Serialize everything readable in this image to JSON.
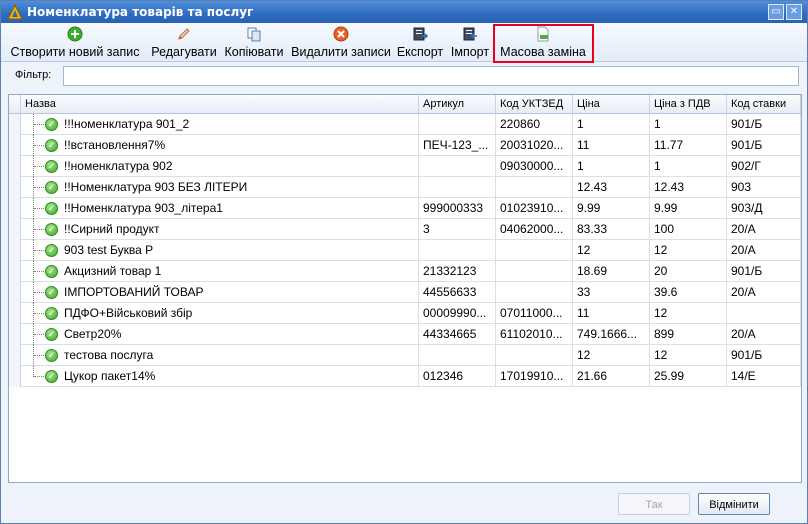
{
  "window": {
    "title": "Номенклатура товарів та послуг"
  },
  "toolbar": {
    "items": [
      {
        "label": "Створити новий запис",
        "icon": "add-icon"
      },
      {
        "label": "Редагувати",
        "icon": "edit-icon"
      },
      {
        "label": "Копіювати",
        "icon": "copy-icon"
      },
      {
        "label": "Видалити записи",
        "icon": "delete-icon"
      },
      {
        "label": "Експорт",
        "icon": "export-icon"
      },
      {
        "label": "Імпорт",
        "icon": "import-icon"
      },
      {
        "label": "Масова заміна",
        "icon": "bulk-replace-icon"
      }
    ],
    "highlight_color": "#e8001c"
  },
  "filter": {
    "label": "Фільтр:",
    "value": ""
  },
  "grid": {
    "columns": [
      "Назва",
      "Артикул",
      "Код УКТЗЕД",
      "Ціна",
      "Ціна з ПДВ",
      "Код ставки"
    ],
    "rows": [
      {
        "name": "!!!номенклатура 901_2",
        "article": "",
        "code": "220860",
        "price": "1",
        "price_vat": "1",
        "rate": "901/Б"
      },
      {
        "name": "!!встановлення7%",
        "article": "ПЕЧ-123_...",
        "code": "20031020...",
        "price": "11",
        "price_vat": "11.77",
        "rate": "901/Б"
      },
      {
        "name": "!!номенклатура 902",
        "article": "",
        "code": "09030000...",
        "price": "1",
        "price_vat": "1",
        "rate": "902/Г"
      },
      {
        "name": "!!Номенклатура 903 БЕЗ ЛІТЕРИ",
        "article": "",
        "code": "",
        "price": "12.43",
        "price_vat": "12.43",
        "rate": "903"
      },
      {
        "name": "!!Номенклатура 903_літера1",
        "article": "999000333",
        "code": "01023910...",
        "price": "9.99",
        "price_vat": "9.99",
        "rate": "903/Д"
      },
      {
        "name": "!!Сирний продукт",
        "article": "3",
        "code": "04062000...",
        "price": "83.33",
        "price_vat": "100",
        "rate": "20/А"
      },
      {
        "name": "903 test Буква Р",
        "article": "",
        "code": "",
        "price": "12",
        "price_vat": "12",
        "rate": "20/А"
      },
      {
        "name": "Акцизний товар 1",
        "article": "21332123",
        "code": "",
        "price": "18.69",
        "price_vat": "20",
        "rate": "901/Б"
      },
      {
        "name": "ІМПОРТОВАНИЙ ТОВАР",
        "article": "44556633",
        "code": "",
        "price": "33",
        "price_vat": "39.6",
        "rate": "20/А"
      },
      {
        "name": "ПДФО+Військовий збір",
        "article": "00009990...",
        "code": "07011000...",
        "price": "11",
        "price_vat": "12",
        "rate": ""
      },
      {
        "name": "Светр20%",
        "article": "44334665",
        "code": "61102010...",
        "price": "749.1666...",
        "price_vat": "899",
        "rate": "20/А"
      },
      {
        "name": "тестова послуга",
        "article": "",
        "code": "",
        "price": "12",
        "price_vat": "12",
        "rate": "901/Б"
      },
      {
        "name": "Цукор пакет14%",
        "article": "012346",
        "code": "17019910...",
        "price": "21.66",
        "price_vat": "25.99",
        "rate": "14/Е"
      }
    ]
  },
  "footer": {
    "ok_label": "Так",
    "cancel_label": "Відмінити"
  }
}
